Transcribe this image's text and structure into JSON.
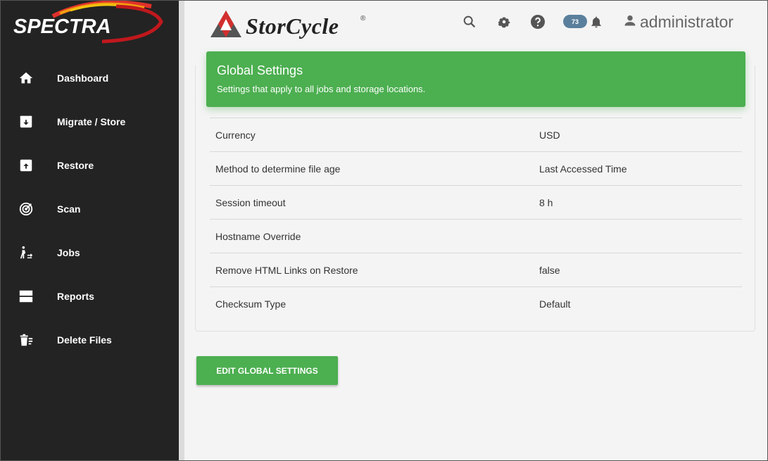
{
  "sidebar": {
    "brand": "SPECTRA",
    "items": [
      {
        "label": "Dashboard",
        "icon": "home-icon"
      },
      {
        "label": "Migrate / Store",
        "icon": "archive-down-icon"
      },
      {
        "label": "Restore",
        "icon": "archive-up-icon"
      },
      {
        "label": "Scan",
        "icon": "scan-icon"
      },
      {
        "label": "Jobs",
        "icon": "jobs-icon"
      },
      {
        "label": "Reports",
        "icon": "reports-icon"
      },
      {
        "label": "Delete Files",
        "icon": "delete-files-icon"
      }
    ]
  },
  "header": {
    "logo_text": "StorCycle",
    "logo_reg": "®",
    "notification_count": "73",
    "username": "administrator"
  },
  "card": {
    "title": "Global Settings",
    "subtitle": "Settings that apply to all jobs and storage locations.",
    "rows": [
      {
        "label": "Currency",
        "value": "USD"
      },
      {
        "label": "Method to determine file age",
        "value": "Last Accessed Time"
      },
      {
        "label": "Session timeout",
        "value": "8 h"
      },
      {
        "label": "Hostname Override",
        "value": ""
      },
      {
        "label": "Remove HTML Links on Restore",
        "value": "false"
      },
      {
        "label": "Checksum Type",
        "value": "Default"
      }
    ]
  },
  "actions": {
    "edit_label": "EDIT GLOBAL SETTINGS"
  },
  "colors": {
    "sidebar_bg": "#232323",
    "accent_green": "#4caf50",
    "badge_bg": "#5a7f9c"
  }
}
